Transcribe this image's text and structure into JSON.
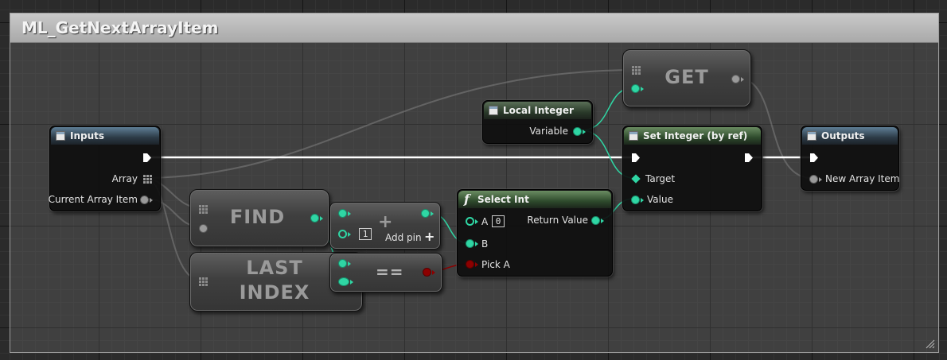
{
  "comment": {
    "title": "ML_GetNextArrayItem"
  },
  "nodes": {
    "inputs": {
      "title": "Inputs",
      "pins": {
        "array": "Array",
        "current_array_item": "Current Array Item"
      }
    },
    "local_integer": {
      "title": "Local Integer",
      "pins": {
        "variable": "Variable"
      }
    },
    "get": {
      "label": "GET"
    },
    "set_integer": {
      "title": "Set Integer (by ref)",
      "pins": {
        "target": "Target",
        "value": "Value"
      }
    },
    "outputs": {
      "title": "Outputs",
      "pins": {
        "new_array_item": "New Array Item"
      }
    },
    "find": {
      "label": "FIND"
    },
    "add": {
      "label": "+",
      "pin_b_value": "1",
      "add_pin": "Add pin"
    },
    "last_index": {
      "label_line1": "LAST",
      "label_line2": "INDEX"
    },
    "equals": {
      "label": "=="
    },
    "select_int": {
      "title": "Select Int",
      "pins": {
        "a": "A",
        "a_value": "0",
        "b": "B",
        "pick_a": "Pick A",
        "return_value": "Return Value"
      }
    }
  },
  "colors": {
    "integer_pin": "#2fd6a4",
    "bool_pin": "#8c0000",
    "wildcard_pin": "#9a9a9a",
    "exec_wire": "#ffffff",
    "comment_header": "#b8b8b8"
  },
  "icons": [
    "function-icon",
    "variable-icon",
    "array-icon",
    "exec-pin-icon",
    "grip-icon",
    "resize-grip-icon"
  ]
}
